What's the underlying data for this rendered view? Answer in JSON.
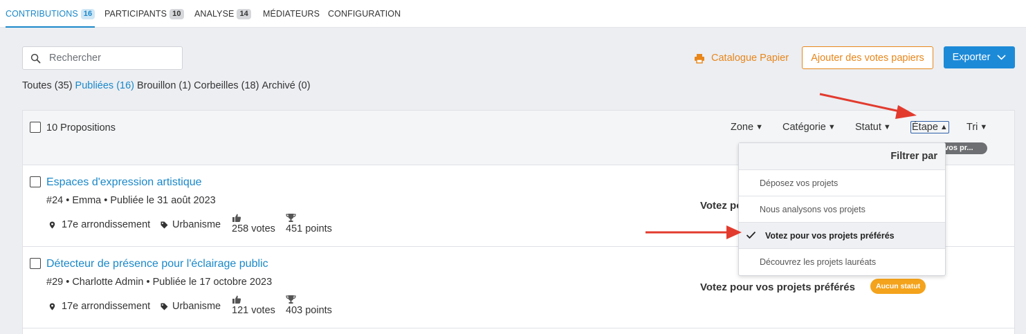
{
  "tabs": [
    {
      "label": "CONTRIBUTIONS",
      "count": "16",
      "active": true
    },
    {
      "label": "PARTICIPANTS",
      "count": "10",
      "active": false
    },
    {
      "label": "ANALYSE",
      "count": "14",
      "active": false
    },
    {
      "label": "MÉDIATEURS",
      "count": "",
      "active": false
    },
    {
      "label": "CONFIGURATION",
      "count": "",
      "active": false
    }
  ],
  "search": {
    "placeholder": "Rechercher",
    "icon": "search-icon"
  },
  "toolbar": {
    "catalog_label": "Catalogue Papier",
    "catalog_icon": "printer-icon",
    "add_votes_label": "Ajouter des votes papiers",
    "export_label": "Exporter",
    "accent": "#e8861a",
    "primary": "#1d8ad8"
  },
  "status_filters": [
    {
      "label": "Toutes (35)",
      "active": false
    },
    {
      "label": "Publiées (16)",
      "active": true
    },
    {
      "label": "Brouillon (1)",
      "active": false
    },
    {
      "label": "Corbeilles (18)",
      "active": false
    },
    {
      "label": "Archivé (0)",
      "active": false
    }
  ],
  "list_header": {
    "count_label": "10 Propositions",
    "filters": {
      "zone": "Zone",
      "category": "Catégorie",
      "status": "Statut",
      "step": "Étape",
      "sort": "Tri"
    },
    "pill_partial": "vos pr..."
  },
  "rows": [
    {
      "title": "Espaces d'expression artistique",
      "meta": "#24 • Emma • Publiée le 31 août 2023",
      "zone": "17e arrondissement",
      "category": "Urbanisme",
      "votes": "258 votes",
      "points": "451 points",
      "step": "Votez po",
      "status_badge": ""
    },
    {
      "title": "Détecteur de présence pour l'éclairage public",
      "meta": "#29 • Charlotte Admin • Publiée le 17 octobre 2023",
      "zone": "17e arrondissement",
      "category": "Urbanisme",
      "votes": "121 votes",
      "points": "403 points",
      "step": "Votez pour vos projets préférés",
      "status_badge": "Aucun statut"
    }
  ],
  "dropdown": {
    "header": "Filtrer par",
    "items": [
      {
        "label": "Déposez vos projets",
        "selected": false
      },
      {
        "label": "Nous analysons vos projets",
        "selected": false
      },
      {
        "label": "Votez pour vos projets préférés",
        "selected": true
      },
      {
        "label": "Découvrez les projets lauréats",
        "selected": false
      }
    ]
  },
  "annotation_color": "#e23b2e"
}
